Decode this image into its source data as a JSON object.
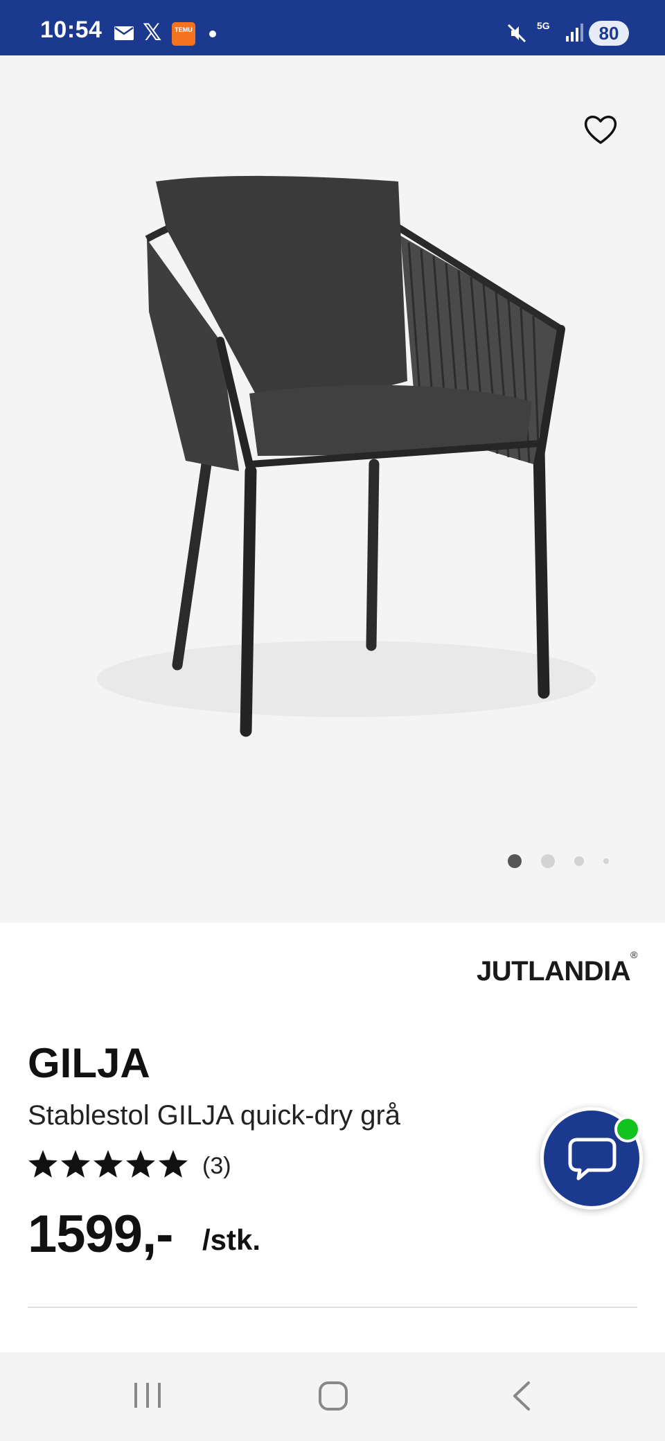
{
  "status_bar": {
    "time": "10:54",
    "icons": [
      "mail-icon",
      "x-icon",
      "temu-icon",
      "notification-dot-icon",
      "mute-icon",
      "5g-icon",
      "signal-icon"
    ],
    "x_glyph": "𝕏",
    "temu_label": "TEMU",
    "network": "5G",
    "battery": "80",
    "background_color": "#1b3a8f"
  },
  "gallery": {
    "icons": [
      "heart-icon"
    ],
    "dots": [
      {
        "state": "active",
        "color": "#555555"
      },
      {
        "state": "inactive",
        "color": "#d3d3d3"
      },
      {
        "state": "inactive",
        "color": "#d3d3d3"
      },
      {
        "state": "inactive",
        "color": "#d3d3d3"
      }
    ],
    "active_index": 0
  },
  "product": {
    "brand": "JUTLANDIA",
    "brand_mark": "®",
    "title": "GILJA",
    "subtitle": "Stablestol GILJA quick-dry grå",
    "rating": 5,
    "rating_max": 5,
    "review_count": "(3)",
    "price": "1599,-",
    "unit": "/stk."
  },
  "chat": {
    "icons": [
      "chat-bubble-icon"
    ],
    "status_color": "#12c21e",
    "button_color": "#1b3a8f"
  },
  "nav_bar": {
    "icons": [
      "recent-apps-icon",
      "home-icon",
      "back-icon"
    ]
  }
}
